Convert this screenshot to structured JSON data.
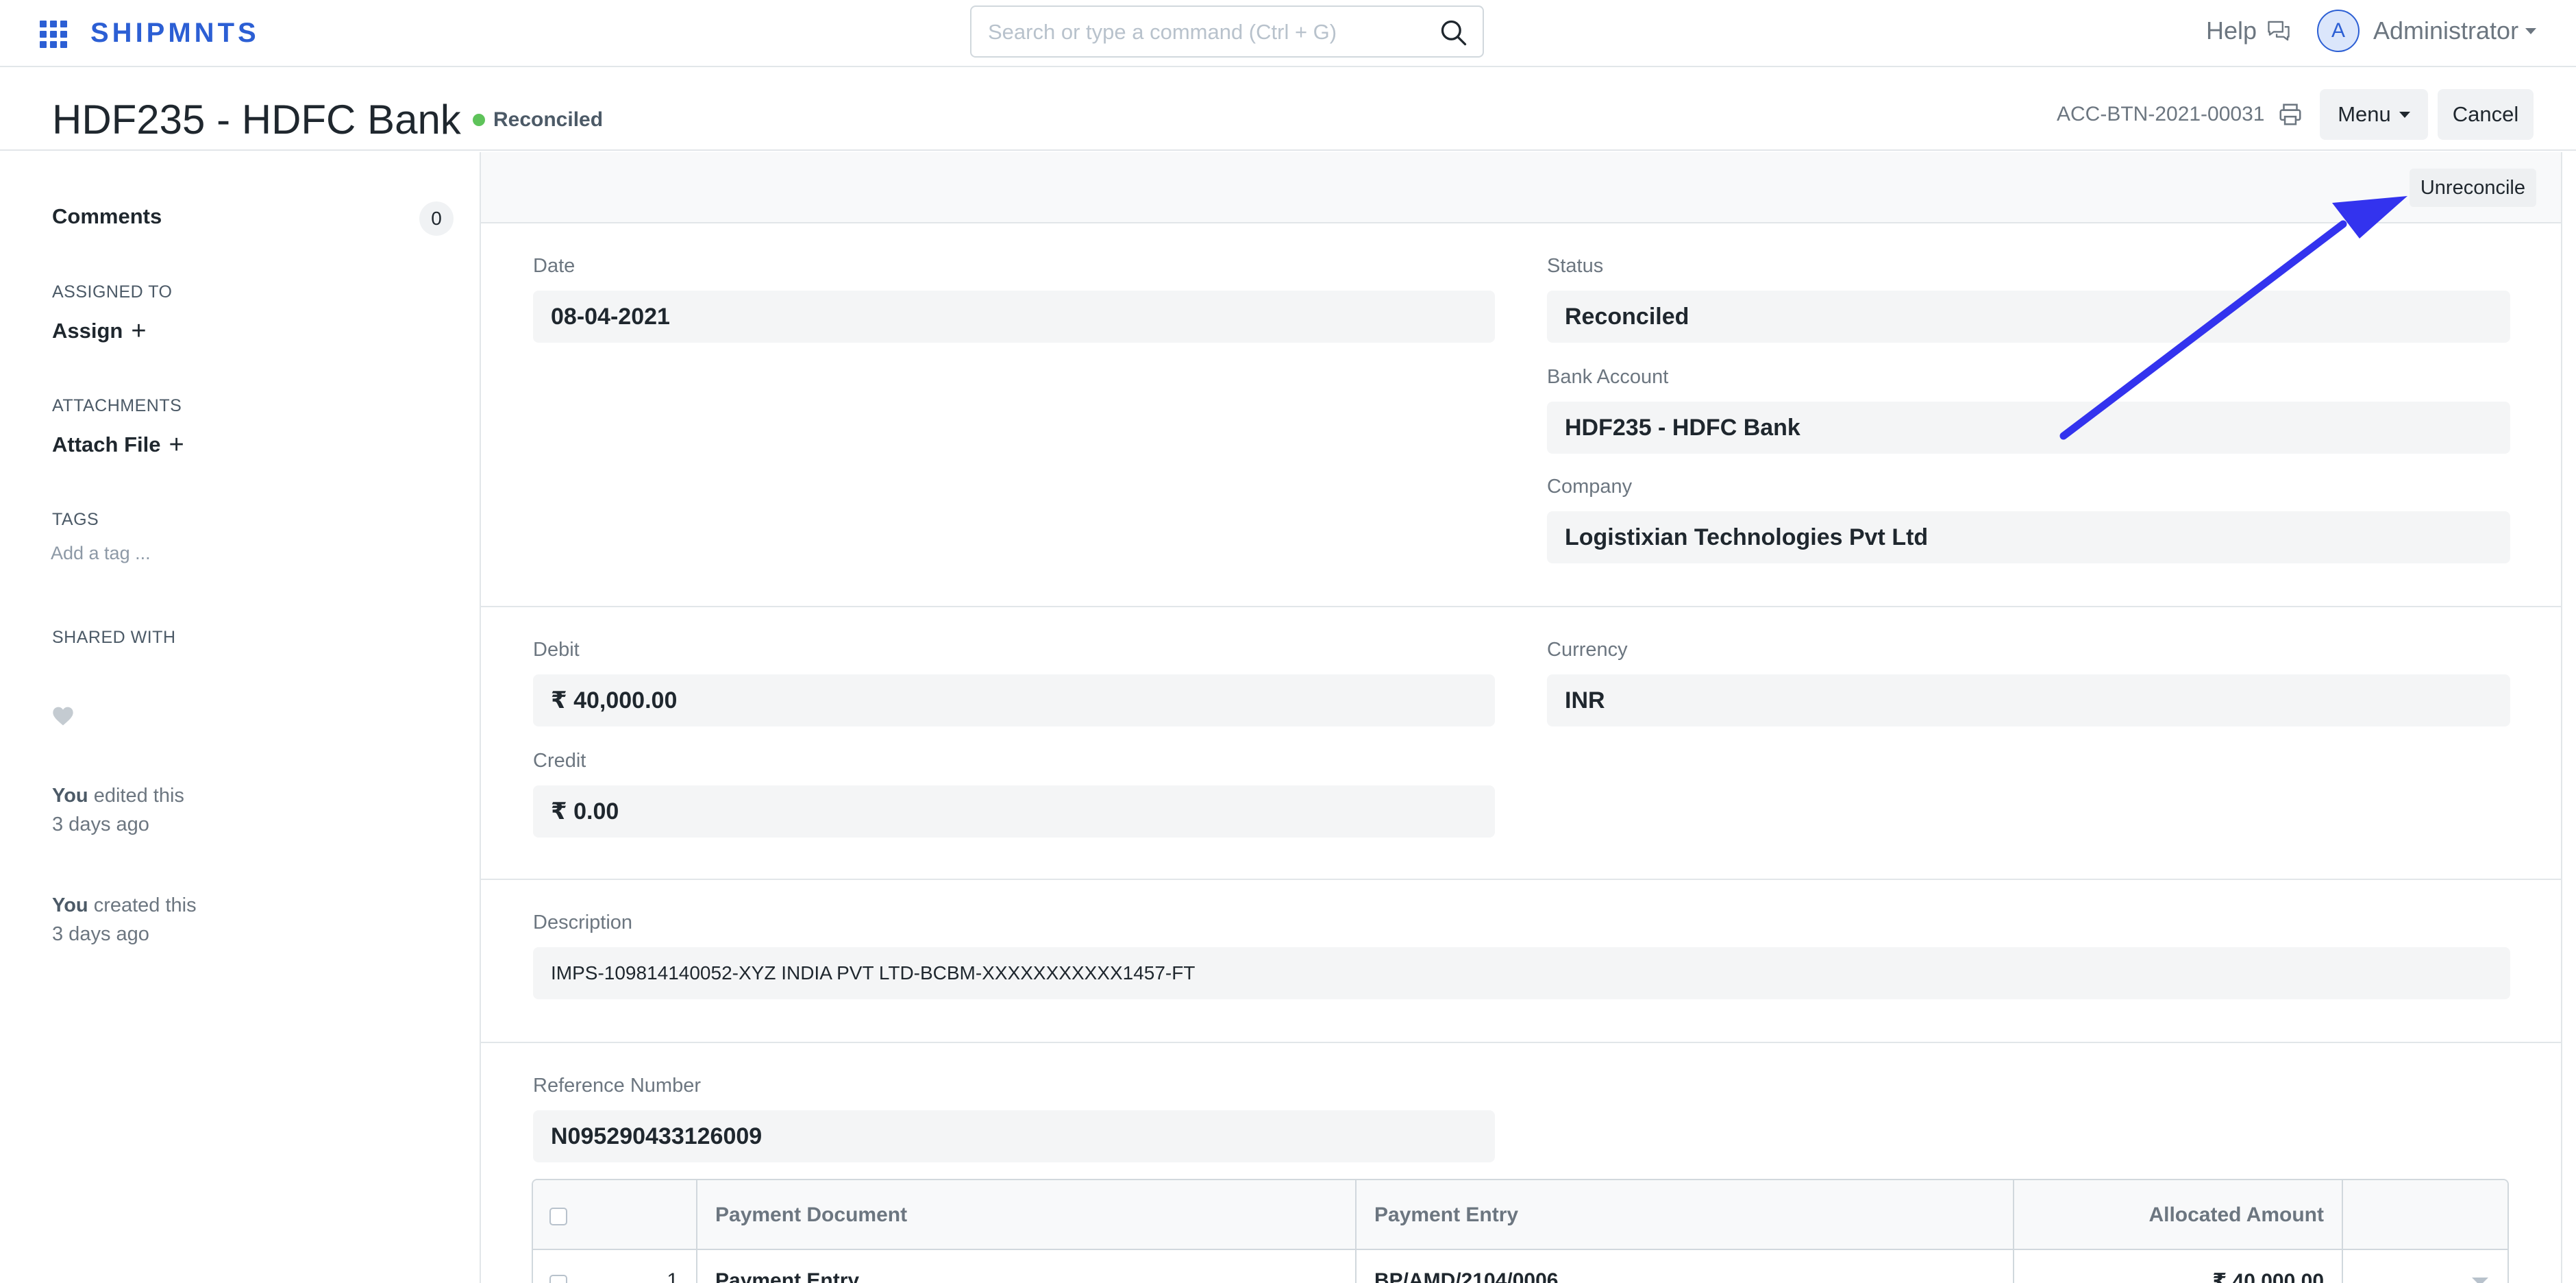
{
  "navbar": {
    "brand": "SHIPMNTS",
    "search_placeholder": "Search or type a command (Ctrl + G)",
    "help_label": "Help",
    "avatar_initial": "A",
    "user_label": "Administrator"
  },
  "page": {
    "title": "HDF235 - HDFC Bank",
    "status": "Reconciled",
    "doc_id": "ACC-BTN-2021-00031",
    "menu_label": "Menu",
    "cancel_label": "Cancel"
  },
  "sidebar": {
    "comments_label": "Comments",
    "comments_count": "0",
    "assigned_to_label": "ASSIGNED TO",
    "assign_label": "Assign",
    "attachments_label": "ATTACHMENTS",
    "attach_label": "Attach File",
    "tags_label": "TAGS",
    "add_tag_label": "Add a tag ...",
    "shared_with_label": "SHARED WITH",
    "activity": [
      {
        "who": "You",
        "action": "edited this",
        "when": "3 days ago"
      },
      {
        "who": "You",
        "action": "created this",
        "when": "3 days ago"
      }
    ]
  },
  "form": {
    "unreconcile_label": "Unreconcile",
    "date_label": "Date",
    "date_value": "08-04-2021",
    "status_label": "Status",
    "status_value": "Reconciled",
    "bank_account_label": "Bank Account",
    "bank_account_value": "HDF235 - HDFC Bank",
    "company_label": "Company",
    "company_value": "Logistixian Technologies Pvt Ltd",
    "debit_label": "Debit",
    "debit_value": "₹ 40,000.00",
    "credit_label": "Credit",
    "credit_value": "₹ 0.00",
    "currency_label": "Currency",
    "currency_value": "INR",
    "description_label": "Description",
    "description_value": "IMPS-109814140052-XYZ INDIA PVT LTD-BCBM-XXXXXXXXXXX1457-FT",
    "reference_label": "Reference Number",
    "reference_value": "N095290433126009"
  },
  "grid": {
    "columns": [
      "Payment Document",
      "Payment Entry",
      "Allocated Amount"
    ],
    "rows": [
      {
        "idx": "1",
        "payment_document": "Payment Entry",
        "payment_entry": "BP/AMD/2104/0006",
        "allocated_amount": "₹ 40,000.00"
      }
    ]
  },
  "colors": {
    "accent": "#2c5fd4",
    "status_dot": "#5ec35a",
    "annotation_arrow": "#3333ee"
  }
}
